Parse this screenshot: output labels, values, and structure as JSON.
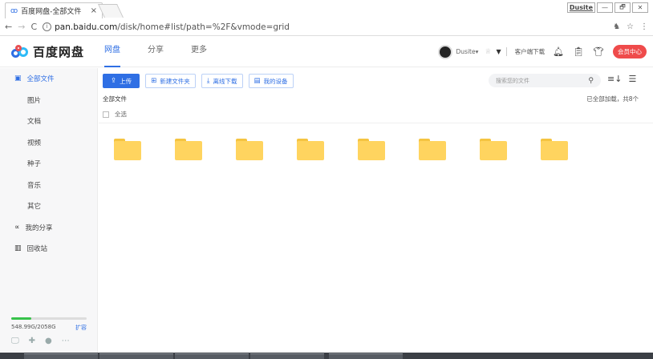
{
  "browser": {
    "tab_title": "百度网盘-全部文件",
    "tab_close": "×",
    "profile_name": "Dusite",
    "window_min": "—",
    "window_max": "🗗",
    "window_close": "✕",
    "nav_back": "←",
    "nav_forward": "→",
    "nav_reload": "C",
    "url_host": "pan.baidu.com",
    "url_path": "/disk/home#list/path=%2F&vmode=grid",
    "extension_icon": "♞",
    "star_icon": "☆",
    "menu_icon": "⋮"
  },
  "header": {
    "logo_text": "百度网盘",
    "nav": [
      "网盘",
      "分享",
      "更多"
    ],
    "username": "Dusite",
    "username_caret": "▾",
    "client_download": "客户端下载",
    "member_center": "会员中心"
  },
  "sidebar": {
    "items": [
      {
        "label": "全部文件",
        "icon": "folder-list-icon"
      },
      {
        "label": "图片"
      },
      {
        "label": "文档"
      },
      {
        "label": "视频"
      },
      {
        "label": "种子"
      },
      {
        "label": "音乐"
      },
      {
        "label": "其它"
      },
      {
        "label": "我的分享",
        "icon": "share-icon"
      },
      {
        "label": "回收站",
        "icon": "trash-icon"
      }
    ],
    "quota_text": "548.99G/2058G",
    "quota_used": 548.99,
    "quota_total": 2058,
    "expand_label": "扩容"
  },
  "toolbar": {
    "upload": "上传",
    "new_folder": "新建文件夹",
    "offline_download": "离线下载",
    "my_devices": "我的设备"
  },
  "search": {
    "placeholder": "搜索您的文件"
  },
  "content": {
    "breadcrumb": "全部文件",
    "loaded_status": "已全部加载，共8个",
    "select_all": "全选",
    "folder_count": 8
  },
  "colors": {
    "accent": "#2f6fe4",
    "member_button": "#ef4b4b",
    "folder": "#ffd45f",
    "quota_fill": "#37c24a"
  }
}
